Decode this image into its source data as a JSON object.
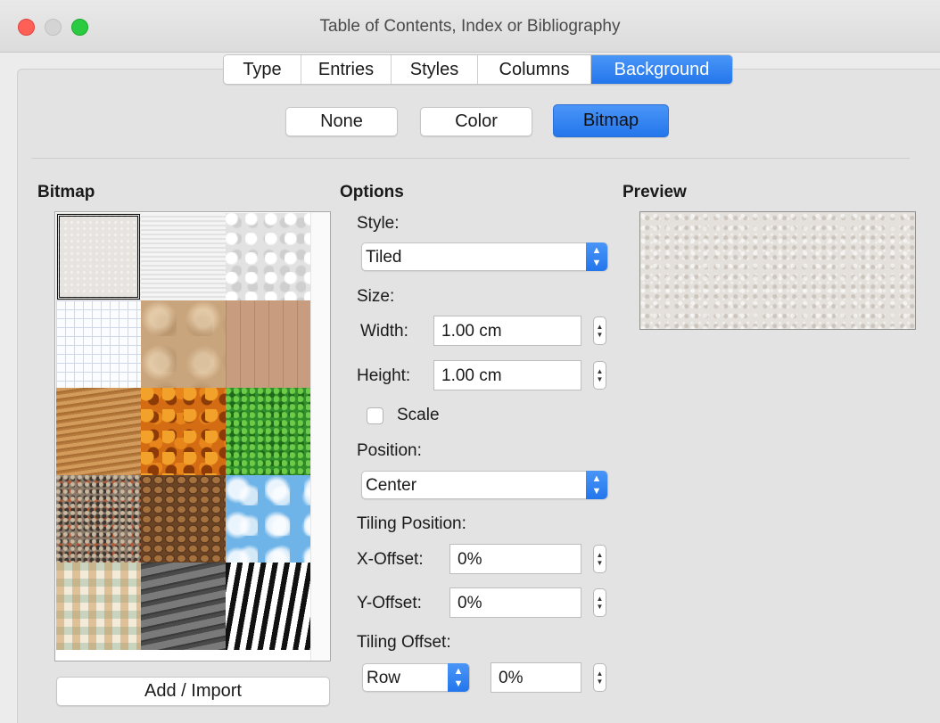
{
  "window": {
    "title": "Table of Contents, Index or Bibliography"
  },
  "tabs": [
    {
      "label": "Type"
    },
    {
      "label": "Entries"
    },
    {
      "label": "Styles"
    },
    {
      "label": "Columns"
    },
    {
      "label": "Background",
      "active": true
    }
  ],
  "fill_buttons": {
    "none": "None",
    "color": "Color",
    "bitmap": "Bitmap",
    "selected": "Bitmap"
  },
  "bitmap_section": {
    "heading": "Bitmap",
    "add_import_label": "Add / Import",
    "selected_index": 0,
    "tiles": [
      {
        "name": "painted-white"
      },
      {
        "name": "paper-texture"
      },
      {
        "name": "paper-crumpled"
      },
      {
        "name": "paper-graph"
      },
      {
        "name": "parchment-paper"
      },
      {
        "name": "fence"
      },
      {
        "name": "wooden-board"
      },
      {
        "name": "maple-leaves"
      },
      {
        "name": "lawn"
      },
      {
        "name": "colorful-pebbles"
      },
      {
        "name": "coffee-beans"
      },
      {
        "name": "little-clouds"
      },
      {
        "name": "color-stripes"
      },
      {
        "name": "stone-wall"
      },
      {
        "name": "zebra"
      }
    ]
  },
  "options": {
    "heading": "Options",
    "style_label": "Style:",
    "style_value": "Tiled",
    "size_label": "Size:",
    "width_label": "Width:",
    "width_value": "1.00 cm",
    "height_label": "Height:",
    "height_value": "1.00 cm",
    "scale_label": "Scale",
    "scale_checked": false,
    "position_label": "Position:",
    "position_value": "Center",
    "tiling_position_label": "Tiling Position:",
    "x_offset_label": "X-Offset:",
    "x_offset_value": "0%",
    "y_offset_label": "Y-Offset:",
    "y_offset_value": "0%",
    "tiling_offset_label": "Tiling Offset:",
    "tiling_offset_mode": "Row",
    "tiling_offset_value": "0%"
  },
  "preview": {
    "heading": "Preview"
  },
  "colors": {
    "accent": "#2f7ff4",
    "close": "#fe5f57",
    "minimize": "#d4d4d4",
    "maximize": "#2acb42"
  }
}
